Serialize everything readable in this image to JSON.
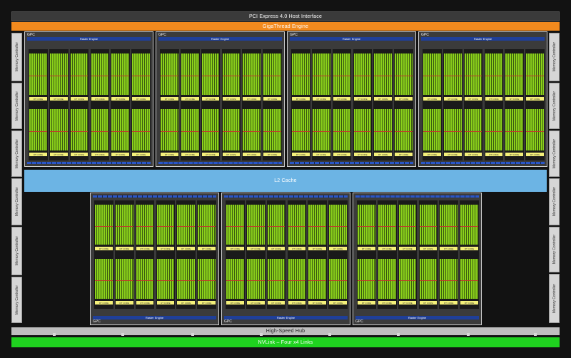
{
  "bars": {
    "pcie": "PCI Express 4.0 Host Interface",
    "gigathread": "GigaThread Engine",
    "l2": "L2 Cache",
    "hub": "High-Speed Hub",
    "nvlink": "NVLink – Four x4 Links"
  },
  "memory_controller_label": "Memory Controller",
  "gpc_label": "GPC",
  "raster_engine": "Raster Engine",
  "rt_core": "RT CORE",
  "colors": {
    "gigathread": "#f28a1e",
    "l2": "#6cb4e4",
    "nvlink": "#1fd21f",
    "raster_engine": "#1f3f99",
    "cuda_cores": "#8bd11b",
    "rt_core": "#f4f07a"
  }
}
